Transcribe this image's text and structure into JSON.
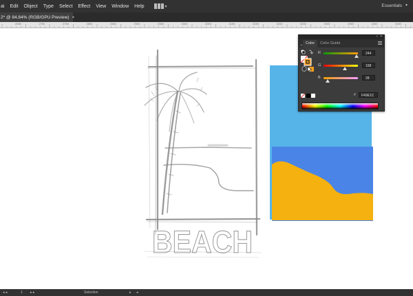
{
  "menubar": {
    "items": [
      "ai",
      "Edit",
      "Object",
      "Type",
      "Select",
      "Effect",
      "View",
      "Window",
      "Help"
    ],
    "workspace": "Essentials"
  },
  "document_tab": {
    "title": "2* @ 84.84% (RGB/GPU Preview)",
    "close": "×"
  },
  "ruler": {
    "labels": [
      "2650",
      "2700",
      "2750",
      "2800",
      "2850",
      "2900",
      "2950",
      "3000",
      "3050",
      "3100",
      "3150",
      "3200",
      "3250",
      "3300",
      "3350",
      "3400",
      "3450"
    ]
  },
  "artwork": {
    "sketch_word": "BEACH",
    "colors": {
      "sky": "#56b4e9",
      "sea": "#4a84e6",
      "sand": "#f4b10f",
      "sketch": "#8a8a8a"
    }
  },
  "color_panel": {
    "collapse_icon": "collapse-arrows-icon",
    "tabs": [
      "Color",
      "Color Guide"
    ],
    "sliders": [
      {
        "label": "R",
        "value": "244",
        "fraction": 0.957,
        "gradient_from": "#0c9a08",
        "gradient_to": "#ff9a08"
      },
      {
        "label": "G",
        "value": "158",
        "fraction": 0.62,
        "gradient_from": "#f40008",
        "gradient_to": "#f4ff08"
      },
      {
        "label": "B",
        "value": "28",
        "fraction": 0.11,
        "gradient_from": "#f49e00",
        "gradient_to": "#f49eff"
      }
    ],
    "hex_prefix": "#",
    "hex_value": "F49E1C",
    "fill_color": "#f49e1c",
    "stroke_color": "#f49e1c"
  },
  "statusbar": {
    "zoom": "1",
    "tool": "Selection"
  }
}
